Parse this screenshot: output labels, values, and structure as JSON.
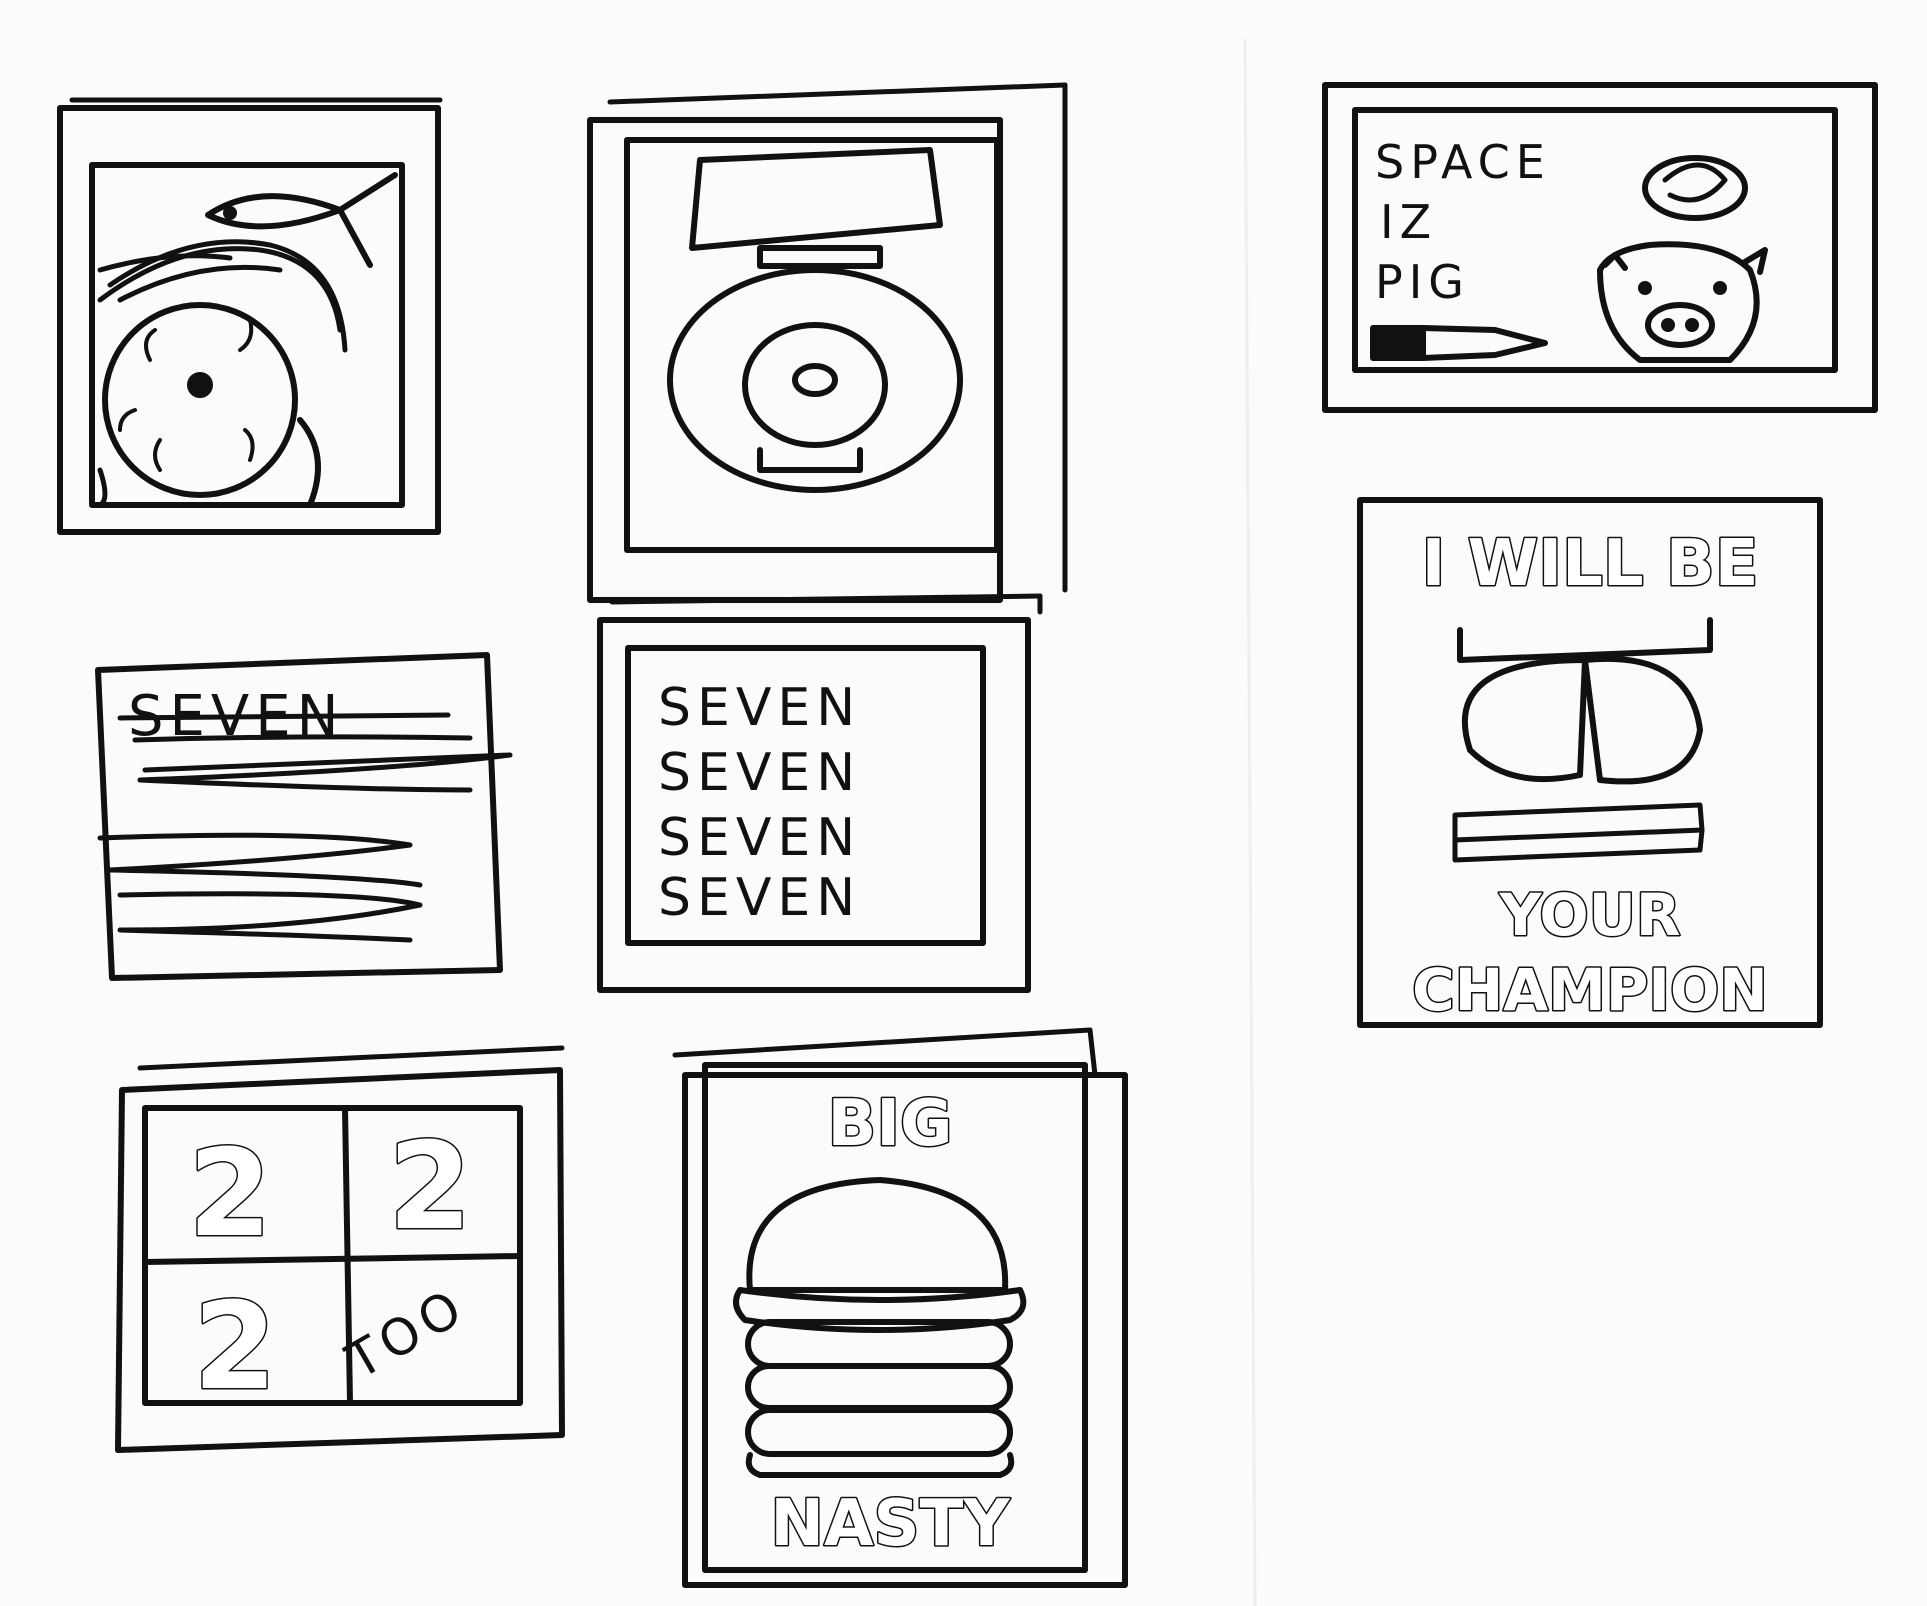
{
  "sketches": {
    "space_pig": {
      "lines": [
        "SPACE",
        "IZ",
        "PIG"
      ]
    },
    "champion": {
      "top": "I WILL BE",
      "bottom1": "YOUR",
      "bottom2": "CHAMPION"
    },
    "seven_strike": {
      "title": "SEVEN"
    },
    "seven_list": {
      "lines": [
        "SEVEN",
        "SEVEN",
        "SEVEN",
        "SEVEN"
      ]
    },
    "twos": {
      "cells": [
        "2",
        "2",
        "2",
        "TOO"
      ]
    },
    "burger": {
      "top": "BIG",
      "bottom": "NASTY"
    }
  },
  "palette": {
    "ink": "#111111",
    "paper": "#fbfbfb"
  }
}
